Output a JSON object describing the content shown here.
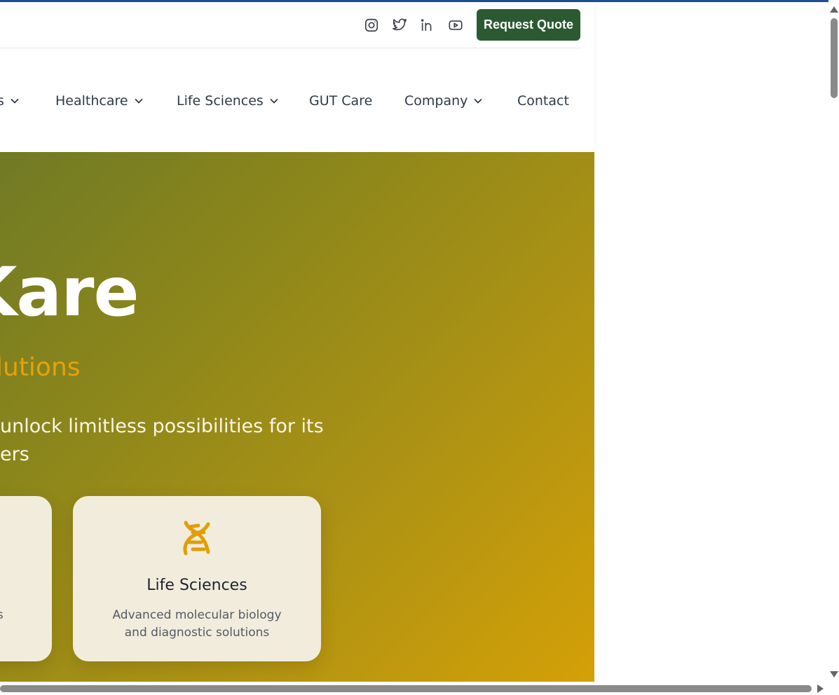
{
  "header": {
    "social_icons": [
      "instagram-icon",
      "twitter-icon",
      "linkedin-icon",
      "youtube-icon"
    ],
    "request_quote_label": "Request Quote"
  },
  "nav": {
    "items": [
      {
        "label": "s",
        "has_dropdown": true
      },
      {
        "label": "Healthcare",
        "has_dropdown": true
      },
      {
        "label": "Life Sciences",
        "has_dropdown": true
      },
      {
        "label": "GUT Care",
        "has_dropdown": false
      },
      {
        "label": "Company",
        "has_dropdown": true
      },
      {
        "label": "Contact",
        "has_dropdown": false
      }
    ]
  },
  "hero": {
    "title": "Kare",
    "subtitle": "lutions",
    "description_line1": "unlock limitless possibilities for its",
    "description_line2": "ers",
    "cards": [
      {
        "title": "",
        "description": "ions"
      },
      {
        "title": "Life Sciences",
        "description": "Advanced molecular biology and diagnostic solutions",
        "icon": "dna-icon"
      }
    ]
  },
  "colors": {
    "brand_green": "#2b5a32",
    "accent_gold": "#e6a20a",
    "hero_gradient_start": "#707a25",
    "hero_gradient_end": "#d4a007",
    "card_bg": "#f2ecdc"
  }
}
